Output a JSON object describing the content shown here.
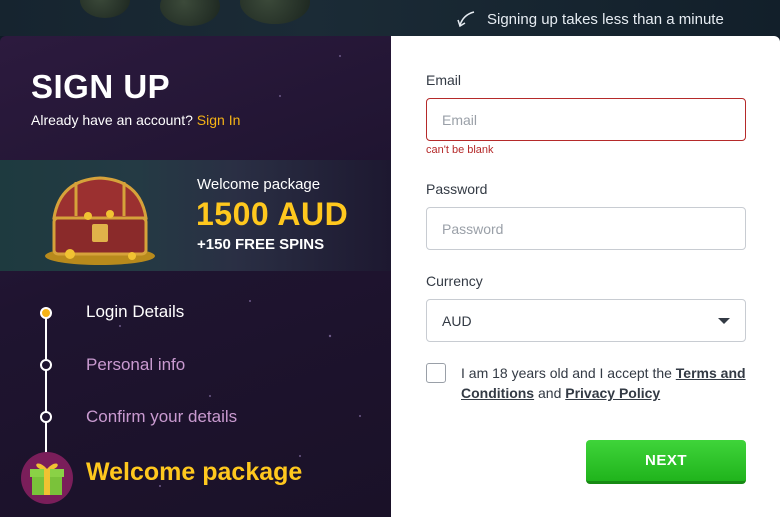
{
  "header": {
    "hint": "Signing up takes less than a minute"
  },
  "left": {
    "title": "SIGN UP",
    "already_text": "Already have an account?",
    "signin_link": "Sign In",
    "promo": {
      "line1": "Welcome package",
      "amount": "1500 AUD",
      "spins": "+150 FREE SPINS"
    },
    "steps": [
      {
        "label": "Login Details",
        "active": true
      },
      {
        "label": "Personal info",
        "active": false
      },
      {
        "label": "Confirm your details",
        "active": false
      }
    ],
    "final_step": "Welcome package"
  },
  "form": {
    "email_label": "Email",
    "email_placeholder": "Email",
    "email_value": "",
    "email_error": "can't be blank",
    "password_label": "Password",
    "password_placeholder": "Password",
    "password_value": "",
    "currency_label": "Currency",
    "currency_value": "AUD",
    "terms_prefix": "I am 18 years old and I accept the",
    "terms_link": "Terms and Conditions",
    "terms_and": "and",
    "privacy_link": "Privacy Policy",
    "terms_checked": false,
    "next_label": "NEXT"
  },
  "colors": {
    "accent": "#f5b316",
    "promo_yellow": "#ffc81e",
    "error": "#b52a2a",
    "next_green": "#20b41c"
  }
}
